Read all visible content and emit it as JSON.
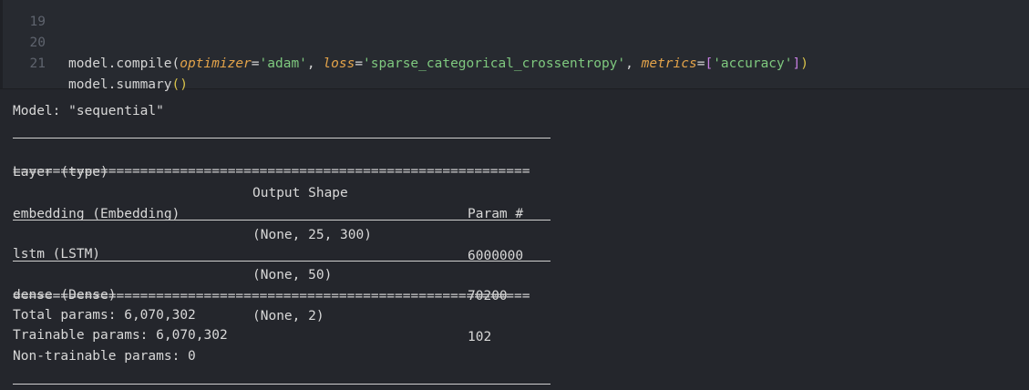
{
  "editor": {
    "lines": [
      {
        "number": "19",
        "text": ""
      },
      {
        "number": "20",
        "parts": {
          "obj": "model.compile(",
          "p1": "optimizer",
          "eq1": "=",
          "v1": "'adam'",
          "sep1": ", ",
          "p2": "loss",
          "eq2": "=",
          "v2": "'sparse_categorical_crossentropy'",
          "sep2": ", ",
          "p3": "metrics",
          "eq3": "=",
          "lb": "[",
          "v3": "'accuracy'",
          "rb": "]",
          "close": ")"
        }
      },
      {
        "number": "21",
        "text": "model.summary",
        "parens": "()"
      }
    ]
  },
  "output": {
    "model_line": "Model: \"sequential\"",
    "headers": [
      "Layer (type)",
      "Output Shape",
      "Param #"
    ],
    "double_rule": "=================================================================",
    "rows": [
      {
        "layer": "embedding (Embedding)",
        "shape": "(None, 25, 300)",
        "params": "6000000"
      },
      {
        "layer": "lstm (LSTM)",
        "shape": "(None, 50)",
        "params": "70200"
      },
      {
        "layer": "dense (Dense)",
        "shape": "(None, 2)",
        "params": "102"
      }
    ],
    "total": "Total params: 6,070,302",
    "trainable": "Trainable params: 6,070,302",
    "non_trainable": "Non-trainable params: 0"
  }
}
